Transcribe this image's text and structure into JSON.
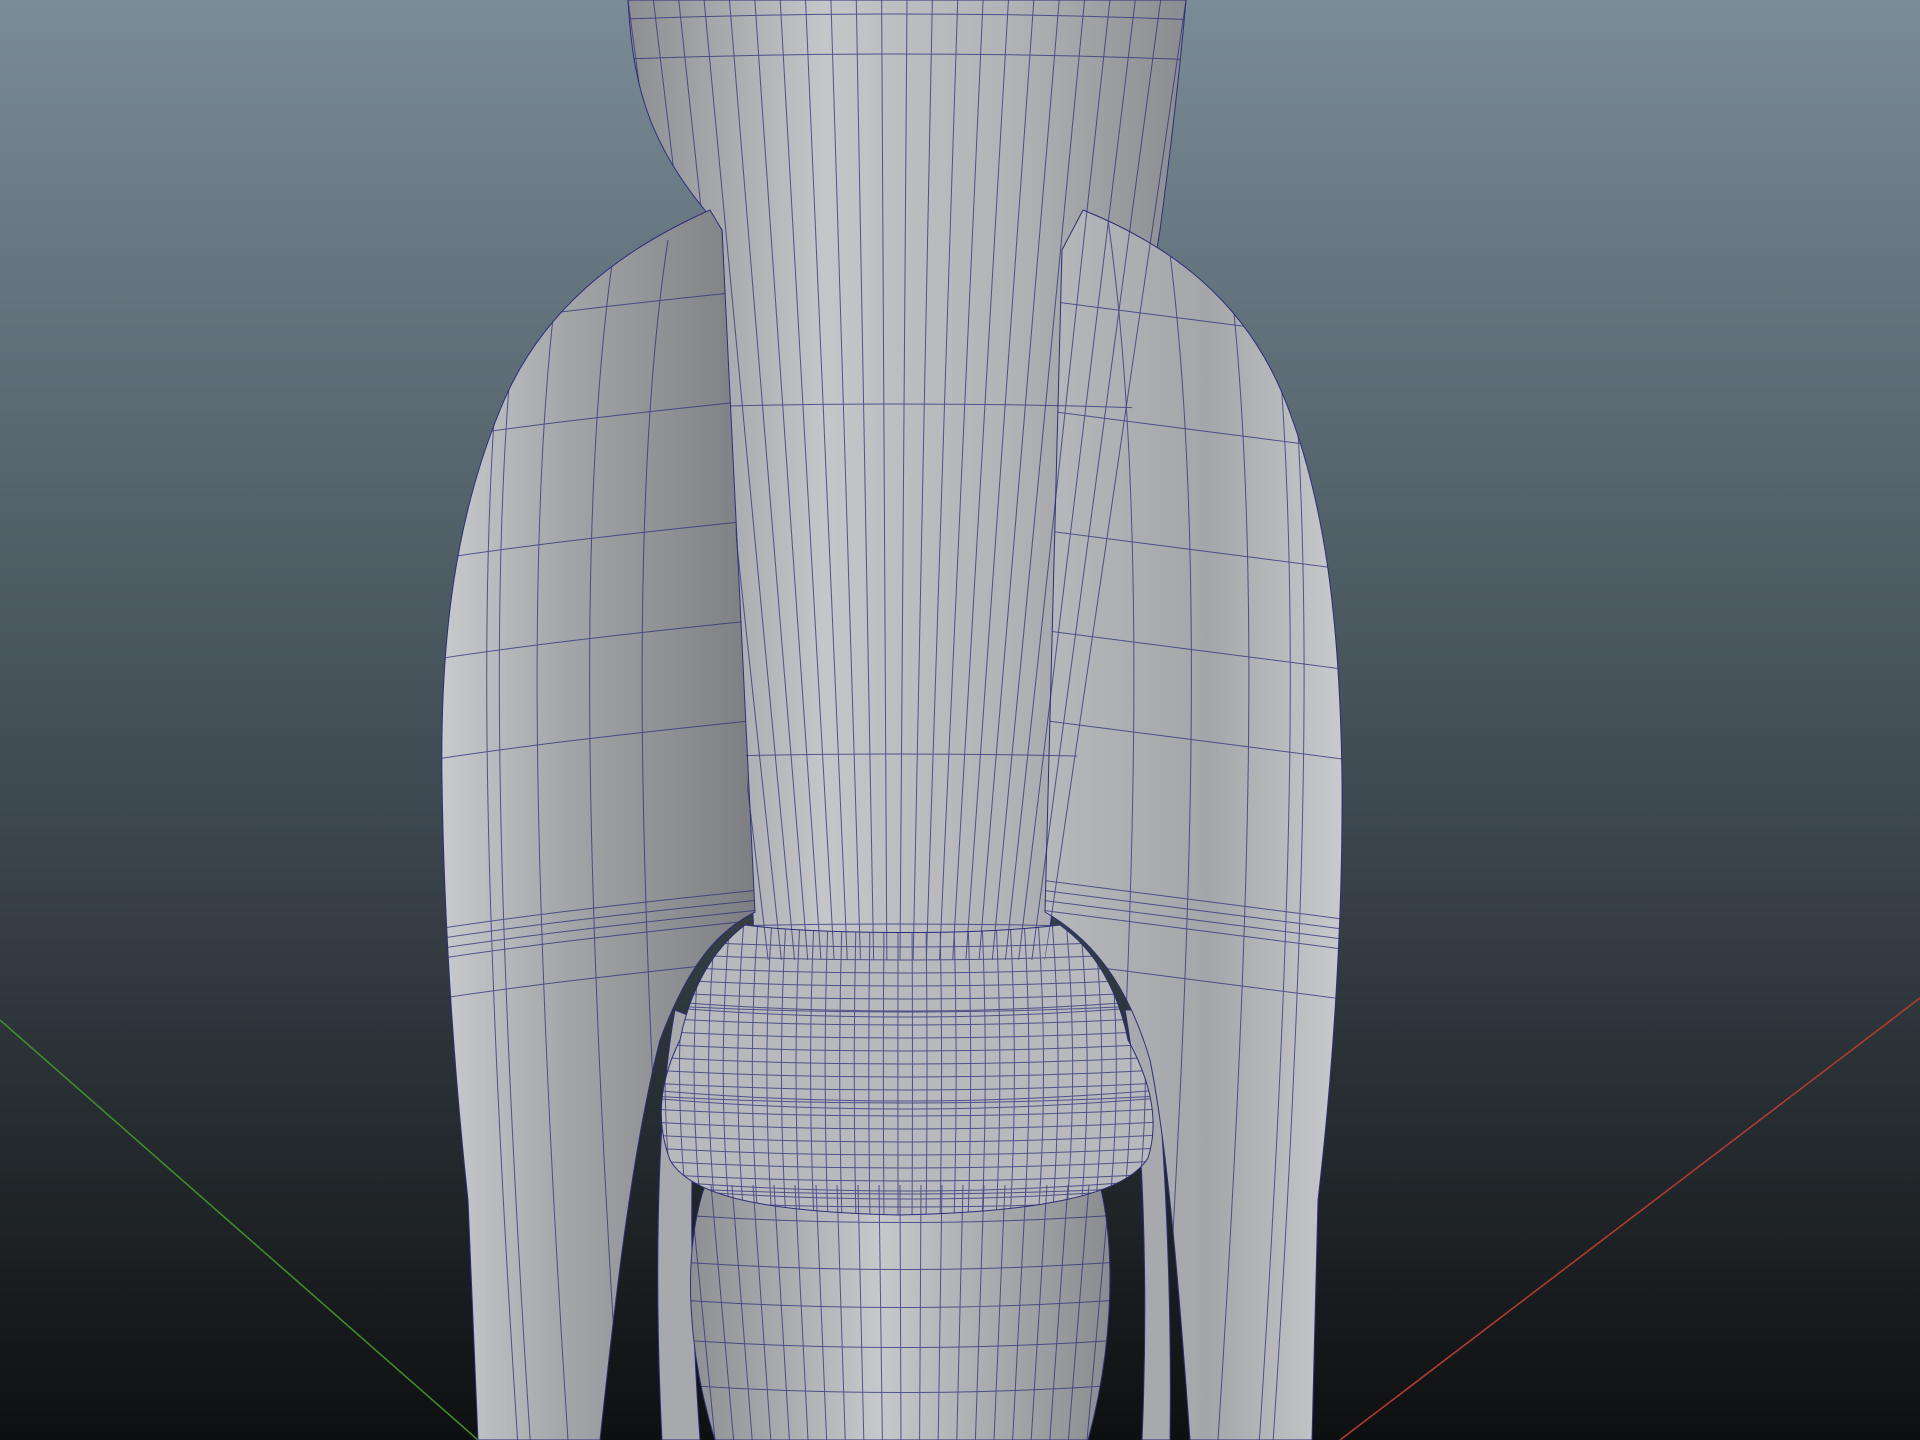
{
  "viewport": {
    "background_top": "#7a8c97",
    "background_bottom": "#0e0f10",
    "model_fill": "#b4b6b9",
    "model_shadow": "#85878b",
    "model_highlight": "#cfd1d4",
    "wire_color": "#2d2f78",
    "grid_axis_x_color": "#b03a32",
    "grid_axis_z_color": "#3f8a2a"
  }
}
